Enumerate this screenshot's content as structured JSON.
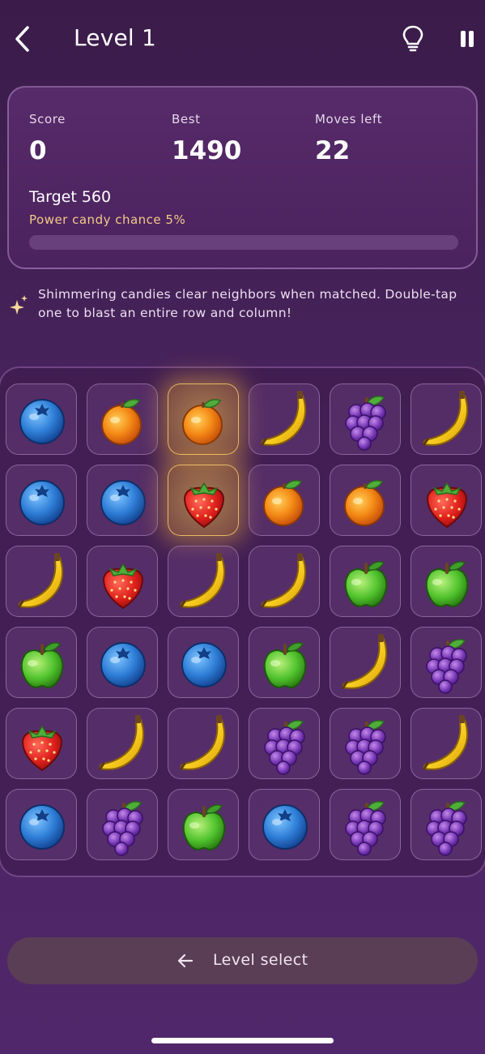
{
  "header": {
    "title": "Level 1",
    "back_icon": "chevron-left-icon",
    "hint_icon": "lightbulb-icon",
    "pause_icon": "pause-icon"
  },
  "stats": {
    "score_label": "Score",
    "score_value": "0",
    "best_label": "Best",
    "best_value": "1490",
    "moves_label": "Moves left",
    "moves_value": "22",
    "target": "Target 560",
    "power_chance": "Power candy chance 5%",
    "progress_fraction": 0
  },
  "info": {
    "icon": "sparkle-icon",
    "text": "Shimmering candies clear neighbors when matched. Double-tap one to blast an entire row and column!"
  },
  "board": {
    "rows": 6,
    "cols": 6,
    "grid": [
      [
        "blueberry",
        "orange",
        "orange",
        "banana",
        "grapes",
        "banana"
      ],
      [
        "blueberry",
        "blueberry",
        "strawberry",
        "orange",
        "orange",
        "strawberry"
      ],
      [
        "banana",
        "strawberry",
        "banana",
        "banana",
        "apple",
        "apple"
      ],
      [
        "apple",
        "blueberry",
        "blueberry",
        "apple",
        "banana",
        "grapes"
      ],
      [
        "strawberry",
        "banana",
        "banana",
        "grapes",
        "grapes",
        "banana"
      ],
      [
        "blueberry",
        "grapes",
        "apple",
        "blueberry",
        "grapes",
        "grapes"
      ]
    ],
    "selected": [
      [
        0,
        2
      ],
      [
        1,
        2
      ]
    ]
  },
  "footer": {
    "level_select_label": "Level select",
    "arrow_icon": "arrow-left-icon"
  },
  "colors": {
    "accent": "#f4c98a",
    "background": "#4a2560"
  }
}
